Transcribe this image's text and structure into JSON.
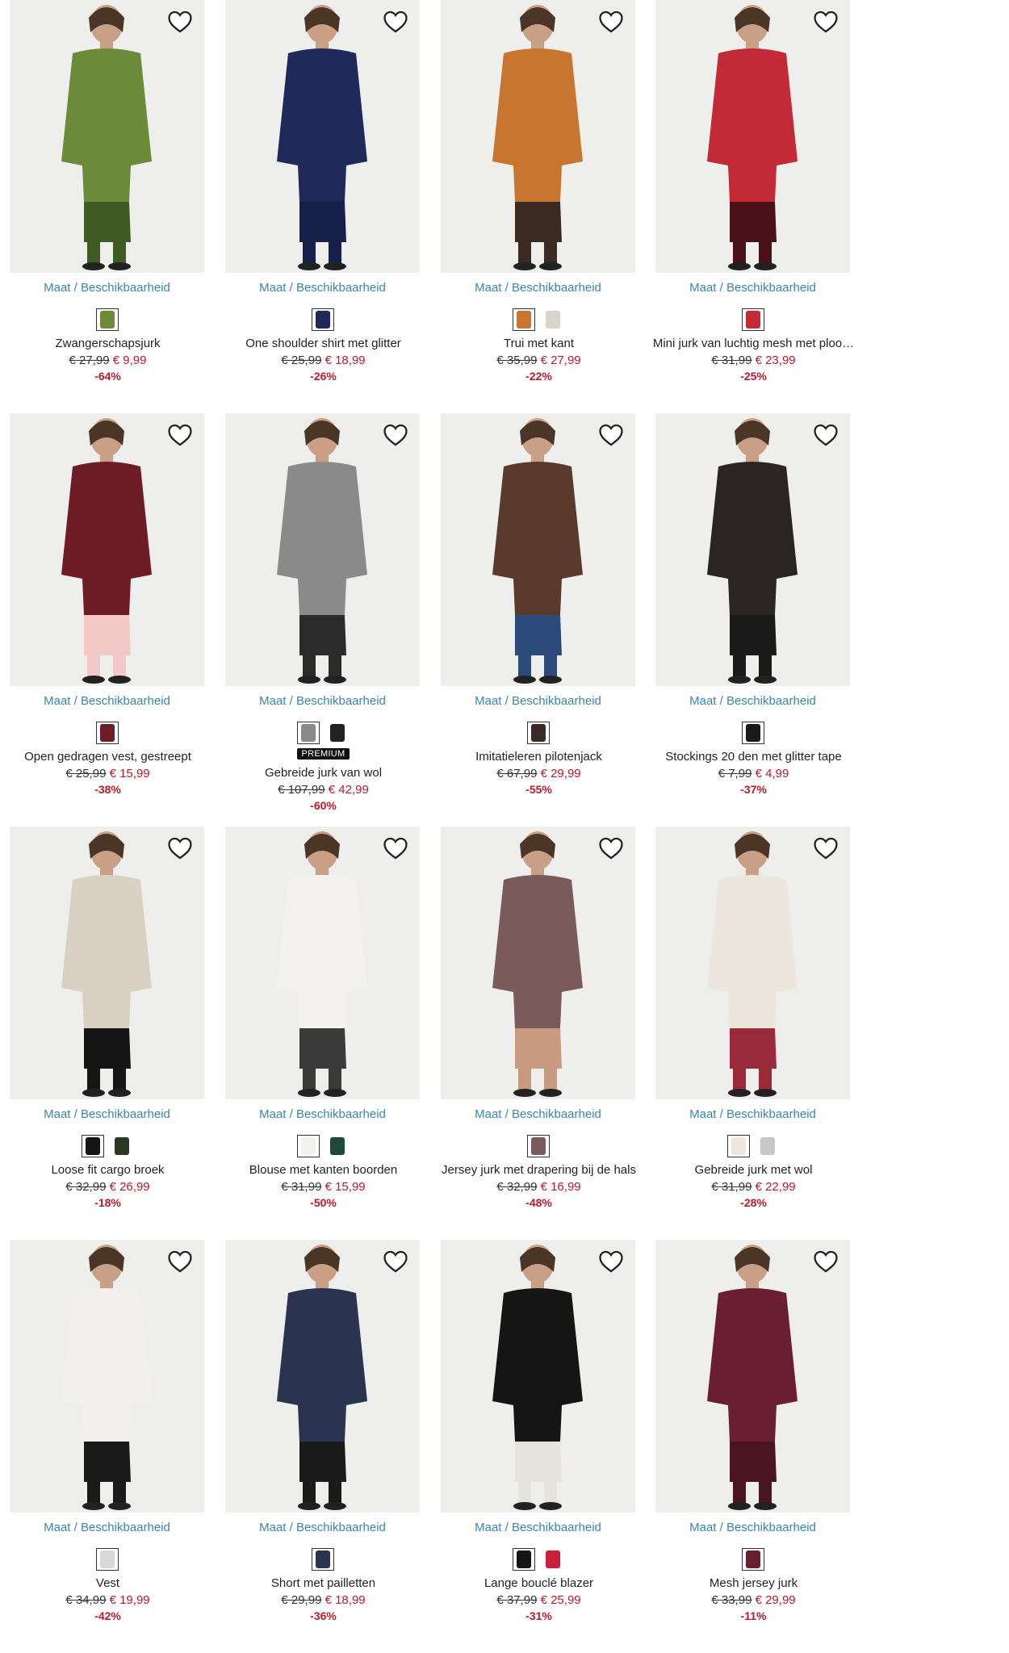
{
  "products": [
    {
      "name": "Zwangerschapsjurk",
      "old_price": "€ 27,99",
      "new_price": "€ 9,99",
      "discount": "-64%",
      "maat": "Maat / Beschikbaarheid",
      "bg": "#eeeeec",
      "main": "#6b8a3a",
      "accent": "#3f5a22",
      "swatches": [
        "#6b8a3a"
      ],
      "premium": ""
    },
    {
      "name": "One shoulder shirt met glitter",
      "old_price": "€ 25,99",
      "new_price": "€ 18,99",
      "discount": "-26%",
      "maat": "Maat / Beschikbaarheid",
      "bg": "#eeeeec",
      "main": "#1f2a5a",
      "accent": "#16204a",
      "swatches": [
        "#1f2a5a"
      ],
      "premium": ""
    },
    {
      "name": "Trui met kant",
      "old_price": "€ 35,99",
      "new_price": "€ 27,99",
      "discount": "-22%",
      "maat": "Maat / Beschikbaarheid",
      "bg": "#eeeeec",
      "main": "#c8752f",
      "accent": "#3a2a22",
      "swatches": [
        "#c8752f",
        "#d8d4c8"
      ],
      "premium": ""
    },
    {
      "name": "Mini jurk van luchtig mesh met ploo…",
      "old_price": "€ 31,99",
      "new_price": "€ 23,99",
      "discount": "-25%",
      "maat": "Maat / Beschikbaarheid",
      "bg": "#eeeeec",
      "main": "#c22a35",
      "accent": "#4a1218",
      "swatches": [
        "#c22a35"
      ],
      "premium": ""
    },
    {
      "name": "Open gedragen vest, gestreept",
      "old_price": "€ 25,99",
      "new_price": "€ 15,99",
      "discount": "-38%",
      "maat": "Maat / Beschikbaarheid",
      "bg": "#eeeeec",
      "main": "#6e1d26",
      "accent": "#f2c9c7",
      "swatches": [
        "#6e1d26"
      ],
      "premium": ""
    },
    {
      "name": "Gebreide jurk van wol",
      "old_price": "€ 107,99",
      "new_price": "€ 42,99",
      "discount": "-60%",
      "maat": "Maat / Beschikbaarheid",
      "bg": "#eeeeec",
      "main": "#8a8a8a",
      "accent": "#2b2b2b",
      "swatches": [
        "#8a8a8a",
        "#222222"
      ],
      "premium": "PREMIUM"
    },
    {
      "name": "Imitatieleren pilotenjack",
      "old_price": "€ 67,99",
      "new_price": "€ 29,99",
      "discount": "-55%",
      "maat": "Maat / Beschikbaarheid",
      "bg": "#eeeeec",
      "main": "#5a3a2c",
      "accent": "#2c4a7a",
      "swatches": [
        "#3a2a24"
      ],
      "premium": ""
    },
    {
      "name": "Stockings 20 den met glitter tape",
      "old_price": "€ 7,99",
      "new_price": "€ 4,99",
      "discount": "-37%",
      "maat": "Maat / Beschikbaarheid",
      "bg": "#eeeeec",
      "main": "#2a2422",
      "accent": "#1a1a1a",
      "swatches": [
        "#1a1a1a"
      ],
      "premium": ""
    },
    {
      "name": "Loose fit cargo broek",
      "old_price": "€ 32,99",
      "new_price": "€ 26,99",
      "discount": "-18%",
      "maat": "Maat / Beschikbaarheid",
      "bg": "#eeeeec",
      "main": "#d9d2c4",
      "accent": "#151515",
      "swatches": [
        "#151515",
        "#2a3a22"
      ],
      "premium": ""
    },
    {
      "name": "Blouse met kanten boorden",
      "old_price": "€ 31,99",
      "new_price": "€ 15,99",
      "discount": "-50%",
      "maat": "Maat / Beschikbaarheid",
      "bg": "#eeeeec",
      "main": "#f4f2ee",
      "accent": "#3a3a3a",
      "swatches": [
        "#f4f2ee",
        "#1d4a3a"
      ],
      "premium": ""
    },
    {
      "name": "Jersey jurk met drapering bij de hals",
      "old_price": "€ 32,99",
      "new_price": "€ 16,99",
      "discount": "-48%",
      "maat": "Maat / Beschikbaarheid",
      "bg": "#eeeeec",
      "main": "#7a5a5a",
      "accent": "#c89a80",
      "swatches": [
        "#7a5a5a"
      ],
      "premium": ""
    },
    {
      "name": "Gebreide jurk met wol",
      "old_price": "€ 31,99",
      "new_price": "€ 22,99",
      "discount": "-28%",
      "maat": "Maat / Beschikbaarheid",
      "bg": "#eeeeec",
      "main": "#ece6dc",
      "accent": "#9a2a3a",
      "swatches": [
        "#efe6e2",
        "#c8c8c4"
      ],
      "premium": ""
    },
    {
      "name": "Vest",
      "old_price": "€ 34,99",
      "new_price": "€ 19,99",
      "discount": "-42%",
      "maat": "Maat / Beschikbaarheid",
      "bg": "#eeeeec",
      "main": "#f2f0ec",
      "accent": "#1a1a1a",
      "swatches": [
        "#d8d8d8"
      ],
      "premium": ""
    },
    {
      "name": "Short met pailletten",
      "old_price": "€ 29,99",
      "new_price": "€ 18,99",
      "discount": "-36%",
      "maat": "Maat / Beschikbaarheid",
      "bg": "#eeeeec",
      "main": "#2a3450",
      "accent": "#1a1a1a",
      "swatches": [
        "#2a3450"
      ],
      "premium": ""
    },
    {
      "name": "Lange bouclé blazer",
      "old_price": "€ 37,99",
      "new_price": "€ 25,99",
      "discount": "-31%",
      "maat": "Maat / Beschikbaarheid",
      "bg": "#eeeeec",
      "main": "#151515",
      "accent": "#e6e2dc",
      "swatches": [
        "#151515",
        "#c8203a"
      ],
      "premium": ""
    },
    {
      "name": "Mesh jersey jurk",
      "old_price": "€ 33,99",
      "new_price": "€ 29,99",
      "discount": "-11%",
      "maat": "Maat / Beschikbaarheid",
      "bg": "#eeeeec",
      "main": "#6a1f30",
      "accent": "#4a1420",
      "swatches": [
        "#6a1f30"
      ],
      "premium": ""
    }
  ]
}
